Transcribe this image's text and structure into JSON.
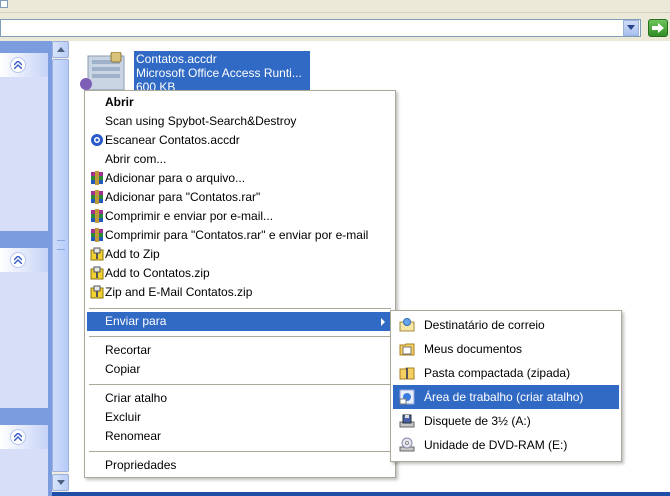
{
  "file": {
    "name": "Contatos.accdr",
    "type": "Microsoft Office Access Runti...",
    "size": "600 KB"
  },
  "context_menu": {
    "items": [
      {
        "label": "Abrir",
        "bold": true
      },
      {
        "label": "Scan using Spybot-Search&Destroy"
      },
      {
        "label": "Escanear Contatos.accdr",
        "icon": "avira-scan-icon"
      },
      {
        "label": "Abrir com..."
      },
      {
        "label": "Adicionar para o arquivo...",
        "icon": "winrar-icon"
      },
      {
        "label": "Adicionar para \"Contatos.rar\"",
        "icon": "winrar-icon"
      },
      {
        "label": "Comprimir e enviar por e-mail...",
        "icon": "winrar-icon"
      },
      {
        "label": "Comprimir para \"Contatos.rar\" e enviar por e-mail",
        "icon": "winrar-icon"
      },
      {
        "label": "Add to Zip",
        "icon": "winzip-icon"
      },
      {
        "label": "Add to Contatos.zip",
        "icon": "winzip-icon"
      },
      {
        "label": "Zip and E-Mail Contatos.zip",
        "icon": "winzip-icon"
      },
      {
        "label": "Enviar para",
        "selected": true,
        "submenu": true
      },
      {
        "label": "Recortar"
      },
      {
        "label": "Copiar"
      },
      {
        "label": "Criar atalho"
      },
      {
        "label": "Excluir"
      },
      {
        "label": "Renomear"
      },
      {
        "label": "Propriedades"
      }
    ]
  },
  "send_to_menu": {
    "items": [
      {
        "label": "Destinatário de correio",
        "icon": "mail-recipient-icon"
      },
      {
        "label": "Meus documentos",
        "icon": "my-documents-icon"
      },
      {
        "label": "Pasta compactada (zipada)",
        "icon": "zip-folder-icon"
      },
      {
        "label": "Área de trabalho (criar atalho)",
        "icon": "desktop-icon",
        "selected": true
      },
      {
        "label": "Disquete de 3½ (A:)",
        "icon": "floppy-drive-icon"
      },
      {
        "label": "Unidade de DVD-RAM (E:)",
        "icon": "dvd-drive-icon"
      }
    ]
  },
  "colors": {
    "selection": "#316ac5",
    "taskpane": "#7b9de0",
    "menu_border": "#aca899"
  }
}
